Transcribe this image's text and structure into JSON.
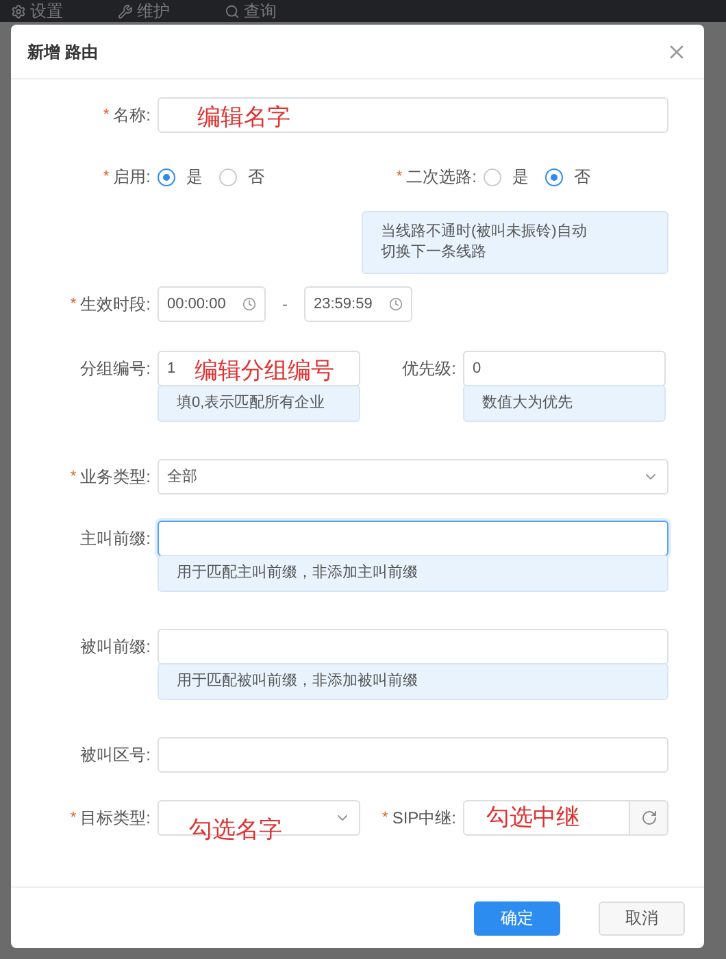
{
  "top_nav": [
    {
      "label": "设置"
    },
    {
      "label": "维护"
    },
    {
      "label": "查询"
    }
  ],
  "dialog": {
    "title": "新增 路由"
  },
  "name": {
    "label": "名称:",
    "required_mark": "*",
    "annotation": "编辑名字"
  },
  "enable": {
    "label": "启用:",
    "required_mark": "*",
    "options": [
      {
        "label": "是",
        "selected": true
      },
      {
        "label": "否",
        "selected": false
      }
    ]
  },
  "reselect": {
    "label": "二次选路:",
    "required_mark": "*",
    "options": [
      {
        "label": "是",
        "selected": false
      },
      {
        "label": "否",
        "selected": true
      }
    ],
    "hint": "当线路不通时(被叫未振铃)自动切换下一条线路"
  },
  "period": {
    "label": "生效时段:",
    "required_mark": "*",
    "start": "00:00:00",
    "separator": "-",
    "end": "23:59:59"
  },
  "group": {
    "label": "分组编号:",
    "value": "1",
    "hint": "填0,表示匹配所有企业",
    "annotation": "编辑分组编号"
  },
  "priority": {
    "label": "优先级:",
    "value": "0",
    "hint": "数值大为优先"
  },
  "business_type": {
    "label": "业务类型:",
    "required_mark": "*",
    "value": "全部"
  },
  "caller_prefix": {
    "label": "主叫前缀:",
    "focused": true,
    "hint": "用于匹配主叫前缀，非添加主叫前缀"
  },
  "callee_prefix": {
    "label": "被叫前缀:",
    "focused": false,
    "hint": "用于匹配被叫前缀，非添加被叫前缀"
  },
  "callee_area": {
    "label": "被叫区号:"
  },
  "target_type": {
    "label": "目标类型:",
    "required_mark": "*",
    "annotation": "勾选名字"
  },
  "sip_trunk": {
    "label": "SIP中继:",
    "required_mark": "*",
    "annotation": "勾选中继"
  },
  "buttons": [
    {
      "label": "确定",
      "kind": "primary"
    },
    {
      "label": "取消",
      "kind": "secondary"
    }
  ]
}
